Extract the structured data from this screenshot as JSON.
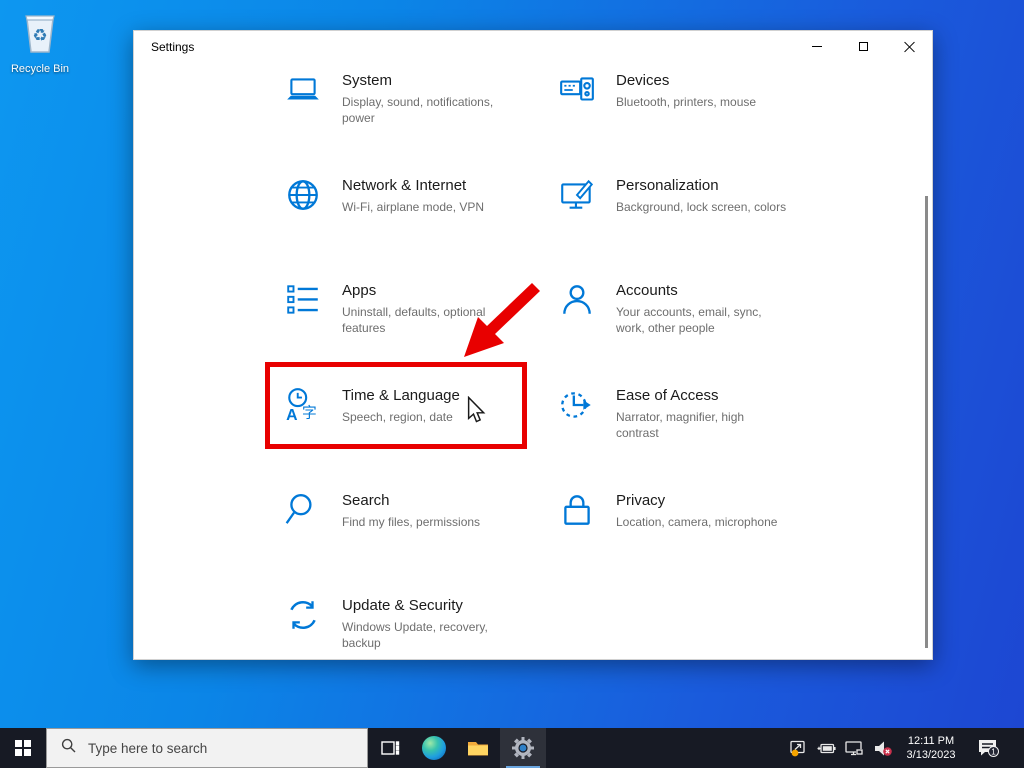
{
  "colors": {
    "accent": "#0078d7",
    "highlight_red": "#e80000",
    "desktop_blue": "#0b85e7",
    "taskbar_dark": "#171a24"
  },
  "desktop": {
    "recycle_bin_label": "Recycle Bin"
  },
  "window": {
    "title": "Settings"
  },
  "settings_tiles": [
    {
      "title": "System",
      "subtitle": "Display, sound, notifications,\npower"
    },
    {
      "title": "Devices",
      "subtitle": "Bluetooth, printers, mouse"
    },
    {
      "title": "Network & Internet",
      "subtitle": "Wi-Fi, airplane mode, VPN"
    },
    {
      "title": "Personalization",
      "subtitle": "Background, lock screen, colors"
    },
    {
      "title": "Apps",
      "subtitle": "Uninstall, defaults, optional\nfeatures"
    },
    {
      "title": "Accounts",
      "subtitle": "Your accounts, email, sync,\nwork, other people"
    },
    {
      "title": "Time & Language",
      "subtitle": "Speech, region, date"
    },
    {
      "title": "Ease of Access",
      "subtitle": "Narrator, magnifier, high\ncontrast"
    },
    {
      "title": "Search",
      "subtitle": "Find my files, permissions"
    },
    {
      "title": "Privacy",
      "subtitle": "Location, camera, microphone"
    },
    {
      "title": "Update & Security",
      "subtitle": "Windows Update, recovery,\nbackup"
    }
  ],
  "annotation": {
    "highlighted_tile": "Time & Language"
  },
  "taskbar": {
    "search_placeholder": "Type here to search",
    "clock": {
      "time": "12:11 PM",
      "date": "3/13/2023"
    },
    "notification_count": "1"
  }
}
